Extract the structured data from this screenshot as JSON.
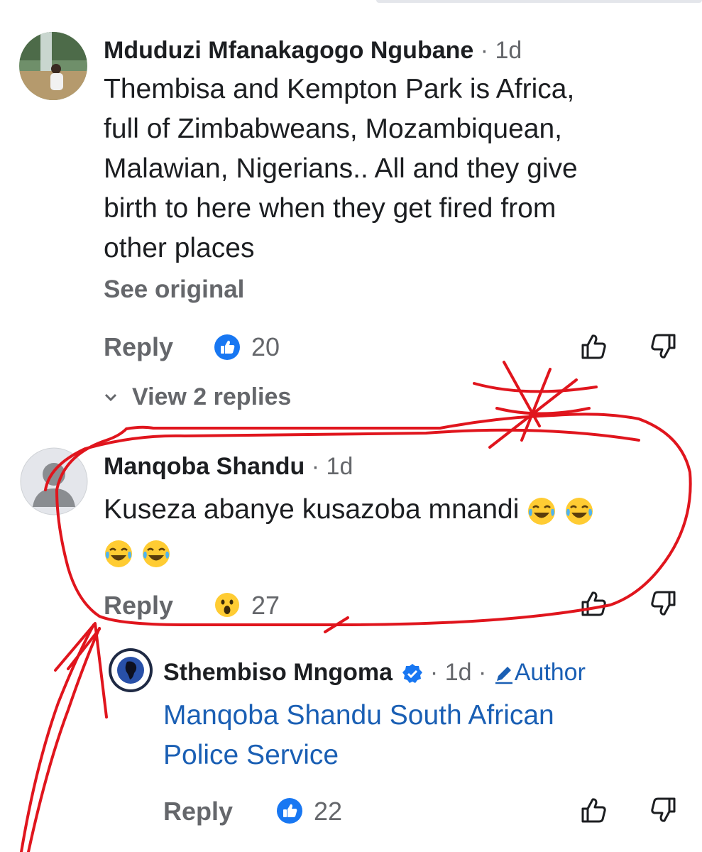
{
  "comments": [
    {
      "author": "Mduduzi Mfanakagogo Ngubane",
      "meta": " · 1d",
      "lines": [
        "Thembisa and Kempton Park is Africa,",
        "full of Zimbabweans, Mozambiquean,",
        "Malawian, Nigerians.. All and they give",
        "birth to here when they get fired from",
        "other places"
      ],
      "see_original": "See original",
      "reply_label": "Reply",
      "reaction_icon": "like-icon",
      "reaction_count": "20",
      "view_replies": "View 2 replies"
    },
    {
      "author": "Manqoba Shandu",
      "meta": " · 1d",
      "line1": "Kuseza abanye kusazoba mnandi",
      "emoji_icon": "face-with-tears-of-joy-icon",
      "reply_label": "Reply",
      "reaction_icon": "wow-icon",
      "reaction_count": "27"
    },
    {
      "author": "Sthembiso Mngoma",
      "meta_time": " · 1d · ",
      "author_badge": "Author",
      "lines": [
        "Manqoba Shandu South African",
        "Police Service"
      ],
      "reply_label": "Reply",
      "reaction_icon": "like-icon",
      "reaction_count": "22"
    }
  ],
  "colors": {
    "annotation": "#e0151d",
    "like_blue": "#1877f2",
    "secondary_text": "#65676b",
    "link_text": "#1a5fb4"
  }
}
